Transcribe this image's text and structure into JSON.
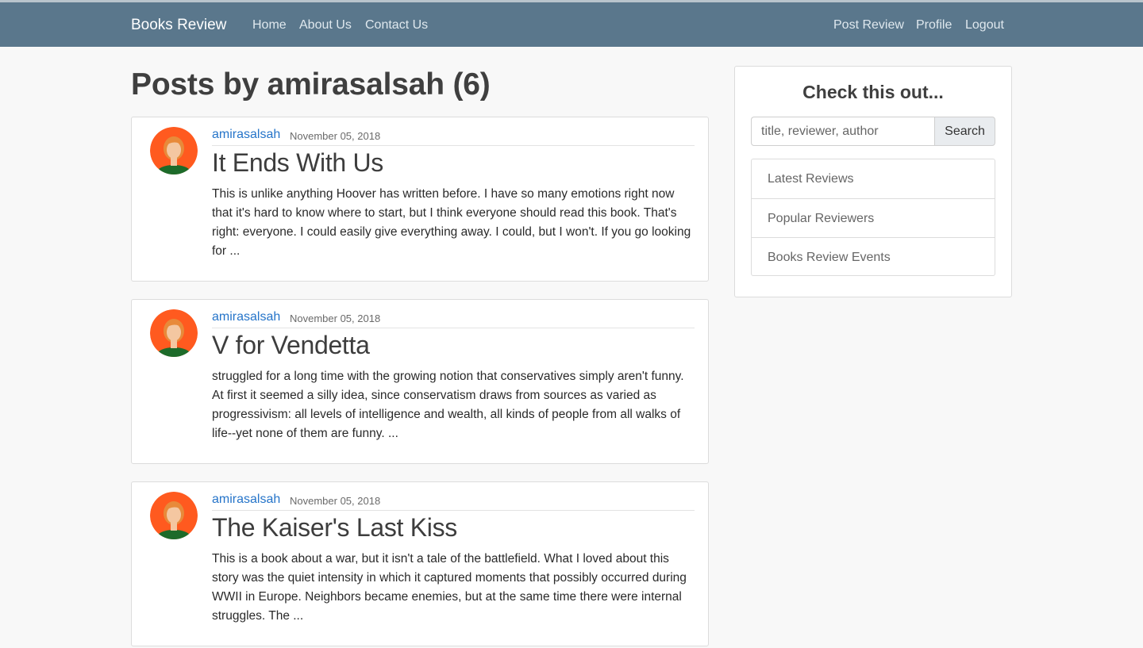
{
  "navbar": {
    "brand": "Books Review",
    "left_links": [
      "Home",
      "About Us",
      "Contact Us"
    ],
    "right_links": [
      "Post Review",
      "Profile",
      "Logout"
    ]
  },
  "main": {
    "title": "Posts by amirasalsah (6)",
    "posts": [
      {
        "author": "amirasalsah",
        "date": "November 05, 2018",
        "title": "It Ends With Us",
        "excerpt": "This is unlike anything Hoover has written before. I have so many emotions right now that it's hard to know where to start, but I think everyone should read this book. That's right: everyone. I could easily give everything away. I could, but I won't. If you go looking for ..."
      },
      {
        "author": "amirasalsah",
        "date": "November 05, 2018",
        "title": "V for Vendetta",
        "excerpt": "struggled for a long time with the growing notion that conservatives simply aren't funny. At first it seemed a silly idea, since conservatism draws from sources as varied as progressivism: all levels of intelligence and wealth, all kinds of people from all walks of life--yet none of them are funny. ..."
      },
      {
        "author": "amirasalsah",
        "date": "November 05, 2018",
        "title": "The Kaiser's Last Kiss",
        "excerpt": "This is a book about a war, but it isn't a tale of the battlefield. What I loved about this story was the quiet intensity in which it captured moments that possibly occurred during WWII in Europe. Neighbors became enemies, but at the same time there were internal struggles. The ..."
      }
    ]
  },
  "sidebar": {
    "heading": "Check this out...",
    "search": {
      "placeholder": "title, reviewer, author",
      "value": "",
      "button_label": "Search"
    },
    "links": [
      "Latest Reviews",
      "Popular Reviewers",
      "Books Review Events"
    ]
  },
  "colors": {
    "navbar": "#5a778c",
    "link": "#2574c9",
    "avatar_bg": "#ff5a1f",
    "avatar_shirt": "#1d6b2a",
    "avatar_hair": "#e88a3a"
  },
  "icons": {
    "avatar": "user-avatar-woman-icon"
  }
}
